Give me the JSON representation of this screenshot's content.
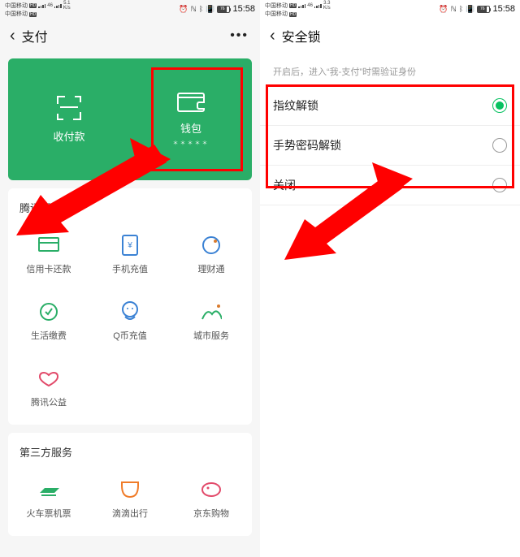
{
  "status": {
    "carrier": "中国移动",
    "hd": "HD",
    "net": "46",
    "speed_left": "5.1",
    "speed_unit": "K/s",
    "speed_right": "3.3",
    "battery_pct": "76",
    "time": "15:58"
  },
  "left": {
    "nav_title": "支付",
    "green": {
      "pay_label": "收付款",
      "wallet_label": "钱包",
      "wallet_sub": "＊＊＊＊＊"
    },
    "tencent_section": "腾讯服务",
    "services": [
      {
        "label": "信用卡还款"
      },
      {
        "label": "手机充值"
      },
      {
        "label": "理财通"
      },
      {
        "label": "生活缴费"
      },
      {
        "label": "Q币充值"
      },
      {
        "label": "城市服务"
      },
      {
        "label": "腾讯公益"
      }
    ],
    "third_section": "第三方服务",
    "third": [
      {
        "label": "火车票机票"
      },
      {
        "label": "滴滴出行"
      },
      {
        "label": "京东购物"
      }
    ]
  },
  "right": {
    "nav_title": "安全锁",
    "hint": "开启后，进入“我-支付”时需验证身份",
    "options": [
      {
        "label": "指纹解锁",
        "selected": true
      },
      {
        "label": "手势密码解锁",
        "selected": false
      },
      {
        "label": "关闭",
        "selected": false
      }
    ]
  }
}
